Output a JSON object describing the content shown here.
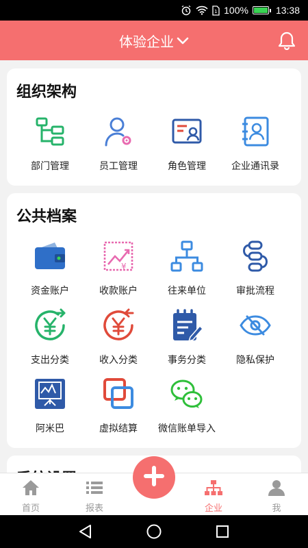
{
  "status_bar": {
    "battery": "100%",
    "time": "13:38",
    "battery_level": 1.0,
    "icons": [
      "alarm-icon",
      "wifi-icon",
      "sim-icon",
      "battery-icon"
    ]
  },
  "header": {
    "title": "体验企业",
    "dropdown_icon": "chevron-down-icon",
    "bell_icon": "bell-icon"
  },
  "org": {
    "title": "组织架构",
    "items": [
      {
        "label": "部门管理",
        "icon": "org-chart-icon",
        "color": "#26b36a"
      },
      {
        "label": "员工管理",
        "icon": "employee-gear-icon",
        "color": "#4a7fd6"
      },
      {
        "label": "角色管理",
        "icon": "role-card-icon",
        "color": "#2f5aa8"
      },
      {
        "label": "企业通讯录",
        "icon": "contacts-book-icon",
        "color": "#3c8be0"
      }
    ]
  },
  "archive": {
    "title": "公共档案",
    "items": [
      {
        "label": "资金账户",
        "icon": "wallet-icon",
        "color": "#2f6fc8"
      },
      {
        "label": "收款账户",
        "icon": "yen-growth-icon",
        "color": "#e86ab0"
      },
      {
        "label": "往来单位",
        "icon": "hierarchy-icon",
        "color": "#3c8be0"
      },
      {
        "label": "审批流程",
        "icon": "workflow-icon",
        "color": "#2f5aa8"
      },
      {
        "label": "支出分类",
        "icon": "yen-out-icon",
        "color": "#26b36a"
      },
      {
        "label": "收入分类",
        "icon": "yen-in-icon",
        "color": "#e04a3a"
      },
      {
        "label": "事务分类",
        "icon": "notepad-pen-icon",
        "color": "#2f5aa8"
      },
      {
        "label": "隐私保护",
        "icon": "eye-slash-icon",
        "color": "#3c8be0"
      },
      {
        "label": "阿米巴",
        "icon": "presentation-board-icon",
        "color": "#2f5aa8"
      },
      {
        "label": "虚拟结算",
        "icon": "overlap-squares-icon",
        "color": "#e04a3a"
      },
      {
        "label": "微信账单导入",
        "icon": "wechat-icon",
        "color": "#2fbf3a"
      }
    ]
  },
  "system": {
    "title": "系统设置"
  },
  "tabbar": {
    "tabs": [
      {
        "label": "首页",
        "icon": "home-icon"
      },
      {
        "label": "报表",
        "icon": "list-icon"
      },
      {
        "label": "企业",
        "icon": "org-chart-icon"
      },
      {
        "label": "我",
        "icon": "user-icon"
      }
    ],
    "fab_icon": "plus-icon"
  },
  "colors": {
    "accent": "#f56f6f",
    "inactive_tab": "#9a9a9a"
  }
}
